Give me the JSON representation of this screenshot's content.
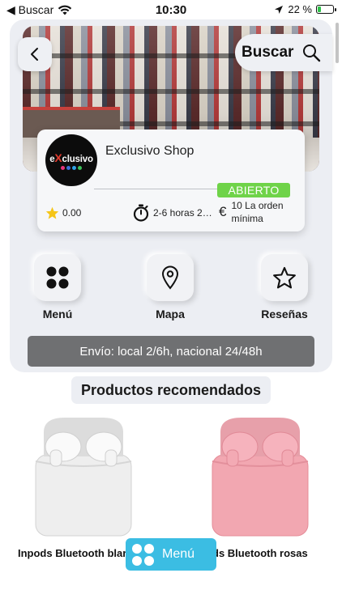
{
  "status_bar": {
    "back_app": "◀ Buscar",
    "time": "10:30",
    "battery": "22 %",
    "battery_level": 0.22,
    "accent": "#2fc24a"
  },
  "header": {
    "back_icon": "chevron-left-icon",
    "search_label": "Buscar",
    "search_icon": "search-icon"
  },
  "shop": {
    "name": "Exclusivo Shop",
    "logo_prefix": "e",
    "logo_x": "X",
    "logo_suffix": "clusivo",
    "status": "ABIERTO",
    "status_color": "#6fd349",
    "rating": "0.00",
    "delivery_time": "2-6 horas 2…",
    "min_order_symbol": "€",
    "min_order": "10 La orden mínima"
  },
  "actions": [
    {
      "label": "Menú",
      "icon": "menu-grid-icon"
    },
    {
      "label": "Mapa",
      "icon": "map-pin-icon"
    },
    {
      "label": "Reseñas",
      "icon": "star-outline-icon"
    }
  ],
  "shipping_banner": "Envío: local 2/6h, nacional 24/48h",
  "recommended": {
    "title": "Productos recomendados",
    "products": [
      {
        "name": "Inpods Bluetooth blar",
        "color": "#f2f2f2"
      },
      {
        "name": "ds Bluetooth rosas",
        "color": "#f0a2ad"
      }
    ]
  },
  "floating_menu": {
    "label": "Menú",
    "color": "#3bbde3"
  }
}
